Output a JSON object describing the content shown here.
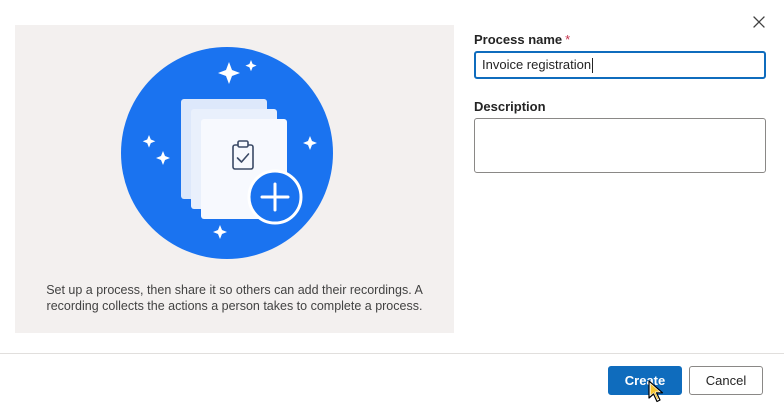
{
  "illustration": {
    "caption_line1": "Set up a process, then share it so others can add their recordings. A",
    "caption_line2": "recording collects the actions a person takes to complete a process.",
    "circle_color": "#1a73f0"
  },
  "form": {
    "process_name_label": "Process name",
    "required_marker": "*",
    "process_name_value": "Invoice registration",
    "description_label": "Description",
    "description_value": ""
  },
  "dialog": {
    "close_icon": "close-icon"
  },
  "footer": {
    "create_label": "Create",
    "cancel_label": "Cancel"
  },
  "colors": {
    "primary": "#0f6cbd",
    "required": "#c4314b",
    "panel_bg": "#f3f0ef"
  }
}
